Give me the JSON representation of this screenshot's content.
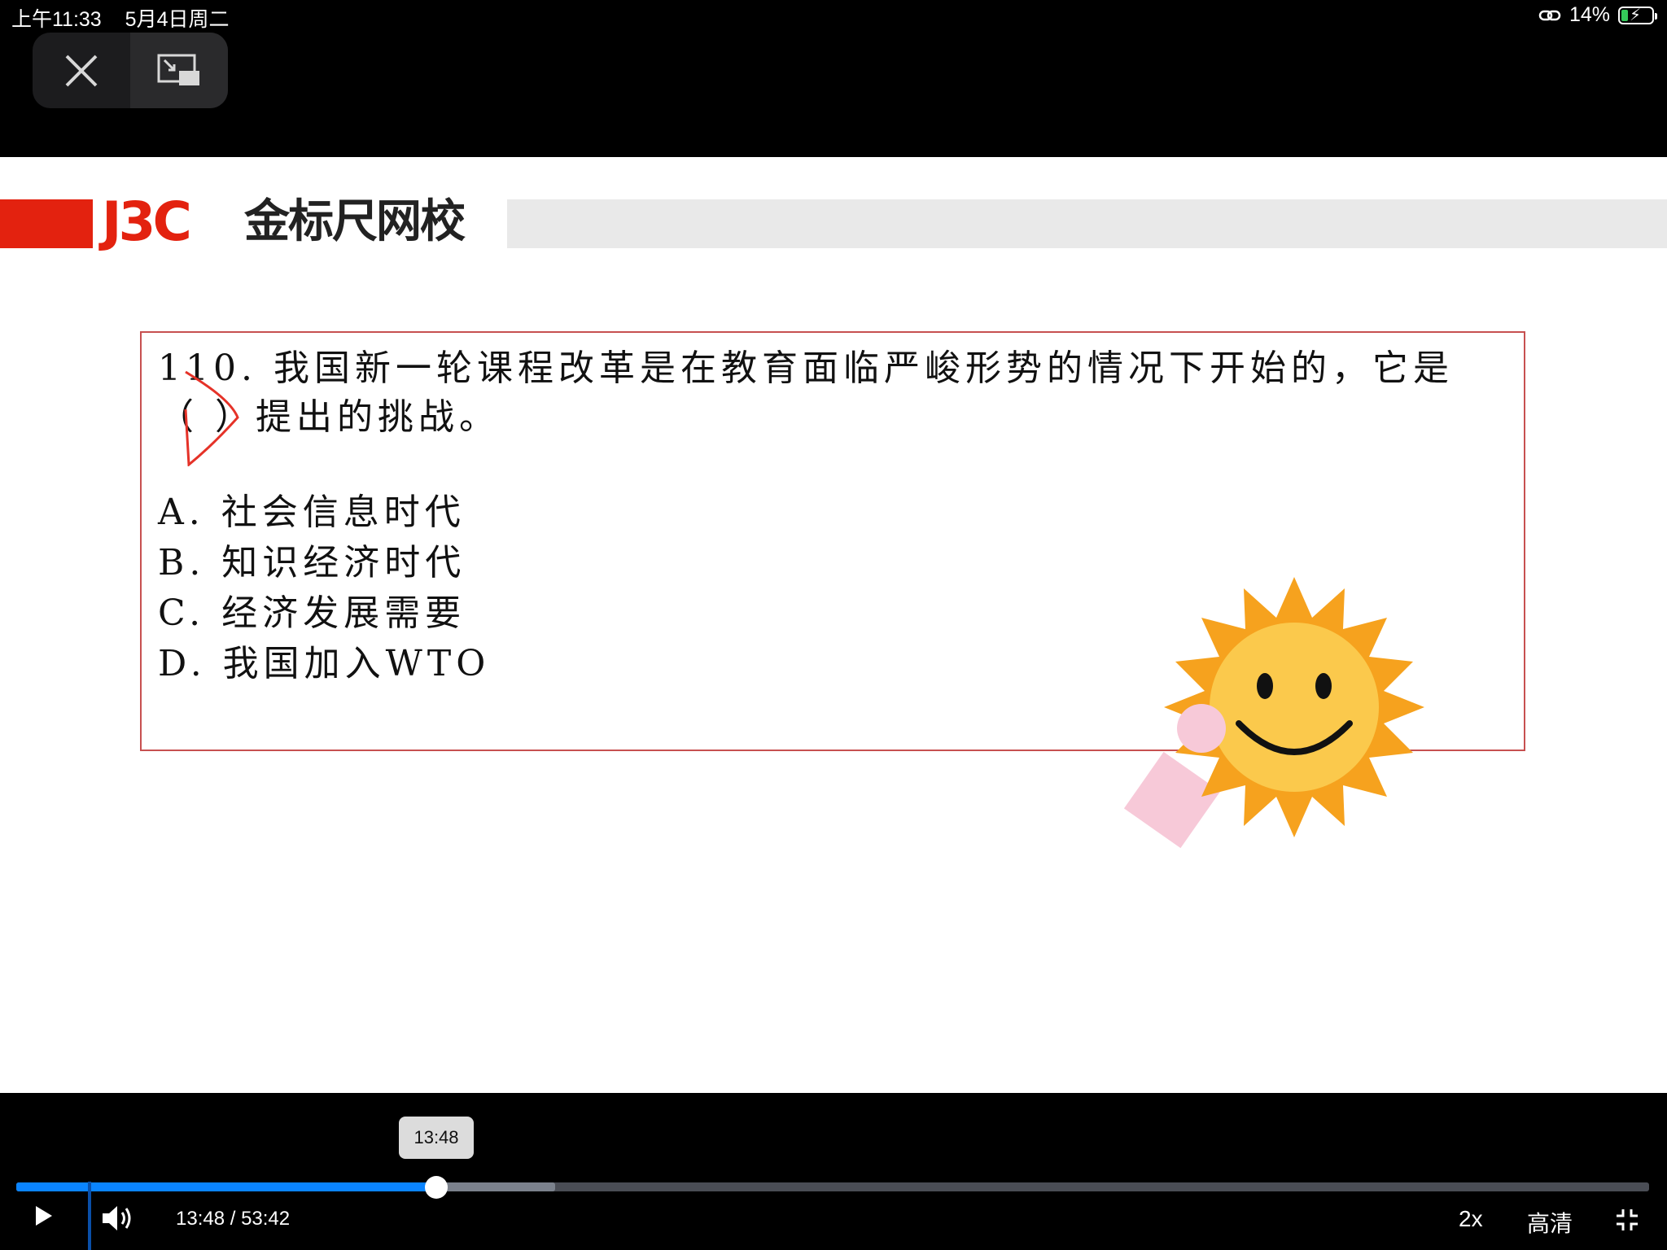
{
  "status": {
    "time": "上午11:33",
    "date": "5月4日周二",
    "battery": "14%"
  },
  "pip": {
    "close": "close",
    "restore": "restore-window"
  },
  "slide": {
    "logo_letters": "J3C",
    "logo_name": "金标尺网校",
    "question_line1": "110. 我国新一轮课程改革是在教育面临严峻形势的情况下开始的，它是",
    "question_line2": "（    ）提出的挑战。",
    "options": [
      "A. 社会信息时代",
      "B. 知识经济时代",
      "C. 经济发展需要",
      "D. 我国加入WTO"
    ],
    "handwritten_answer": "D"
  },
  "player": {
    "tooltip": "13:48",
    "time_display": "13:48 / 53:42",
    "played_fraction": 0.257,
    "buffered_fraction": 0.33,
    "speed": "2x",
    "quality": "高清"
  },
  "colors": {
    "accent": "#0a84ff",
    "brand_red": "#e3220f",
    "box_border": "#c75050"
  }
}
